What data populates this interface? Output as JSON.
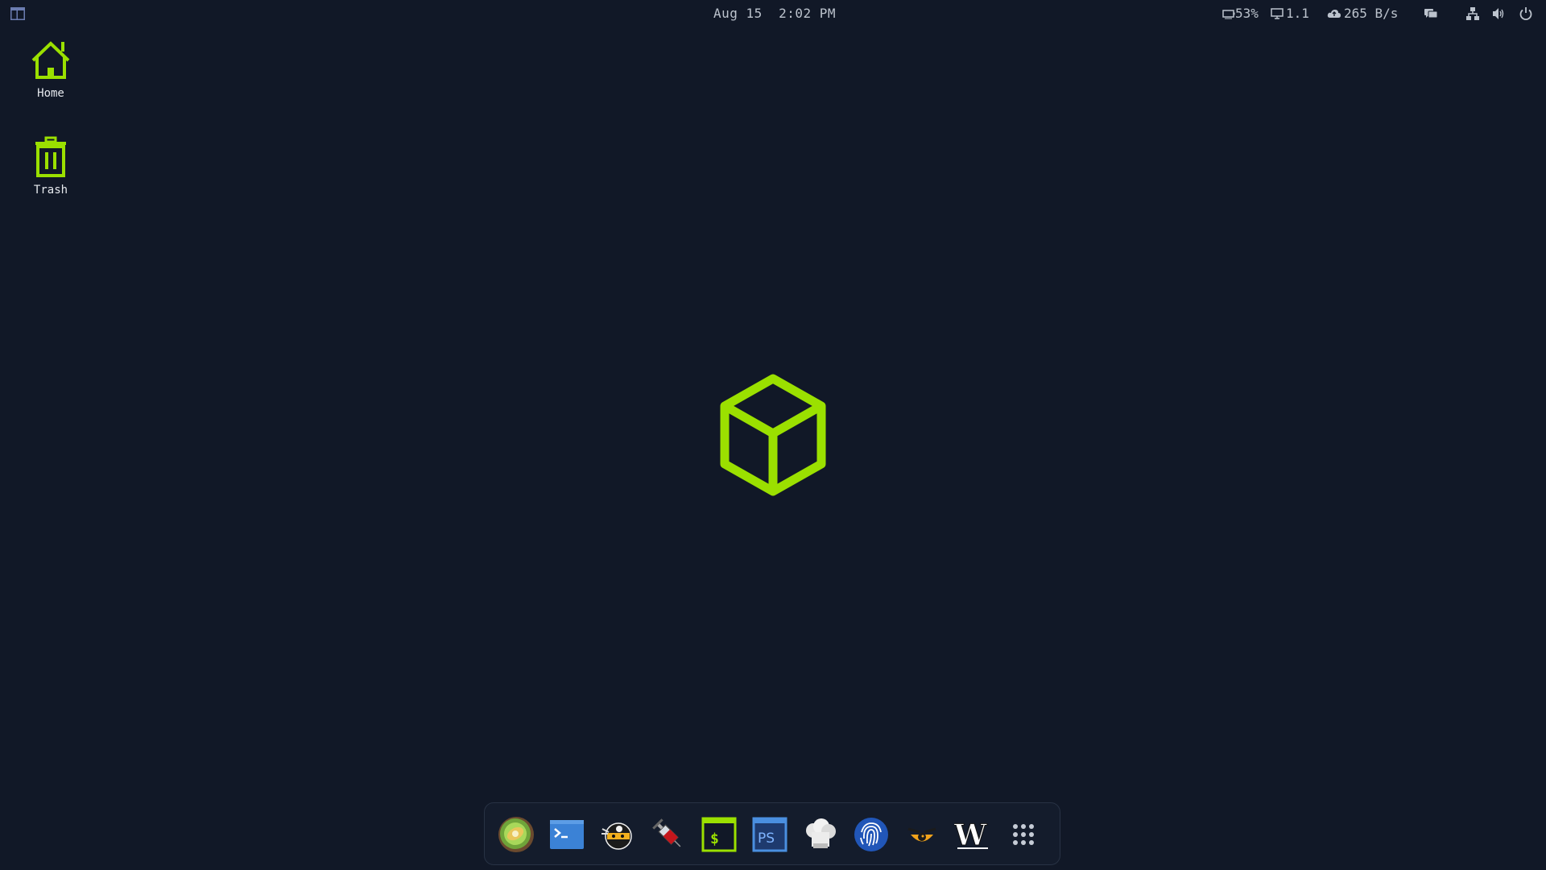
{
  "panel": {
    "menu_icon": "layout-icon",
    "clock_date": "Aug 15",
    "clock_time": "2:02 PM",
    "battery": "53%",
    "cpu_load": "1.1",
    "network_speed": "265 B/s",
    "tray_icons": [
      "chat-icon",
      "network-icon",
      "volume-icon",
      "power-icon"
    ]
  },
  "desktop": {
    "icons": [
      {
        "label": "Home",
        "icon": "home-icon"
      },
      {
        "label": "Trash",
        "icon": "trash-icon"
      }
    ],
    "logo": "cube-logo-icon"
  },
  "dock": {
    "items": [
      "kiwi-app-icon",
      "terminal-app-icon",
      "ninja-app-icon",
      "syringe-app-icon",
      "shell-app-icon",
      "powershell-app-icon",
      "chef-app-icon",
      "fingerprint-app-icon",
      "eye-app-icon",
      "wordlist-app-icon",
      "app-grid-icon"
    ]
  },
  "colors": {
    "background": "#111827",
    "accent": "#9be000",
    "text": "#c6ccd6"
  }
}
